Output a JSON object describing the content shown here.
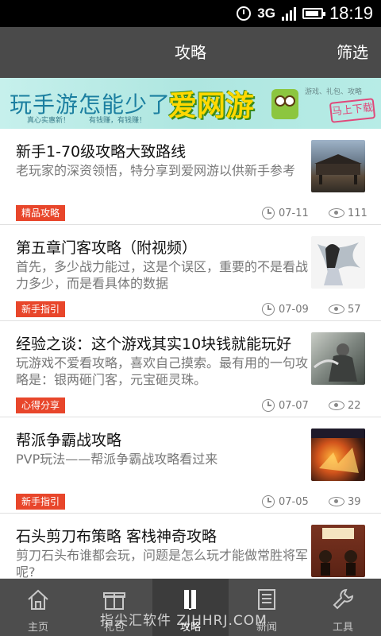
{
  "status_bar": {
    "network": "3G",
    "time": "18:19"
  },
  "header": {
    "title": "攻略",
    "filter_label": "筛选"
  },
  "banner": {
    "slogan": "玩手游怎能少了",
    "small_text_1": "真心实惠新！",
    "small_text_2": "有钱赚，有钱赚！",
    "brand": "爱网游",
    "tagline": "游戏、礼包、攻略",
    "download": "马上下载"
  },
  "articles": [
    {
      "title": "新手1-70级攻略大致路线",
      "desc": "老玩家的深资领悟，特分享到爱网游以供新手参考",
      "tag": "精品攻略",
      "date": "07-11",
      "views": "111"
    },
    {
      "title": "第五章门客攻略（附视频）",
      "desc": "首先，多少战力能过，这是个误区，重要的不是看战力多少，而是看具体的数据",
      "tag": "新手指引",
      "date": "07-09",
      "views": "57"
    },
    {
      "title": "经验之谈：这个游戏其实10块钱就能玩好",
      "desc": "玩游戏不爱看攻略，喜欢自己摸索。最有用的一句攻略是：银两砸门客，元宝砸灵珠。",
      "tag": "心得分享",
      "date": "07-07",
      "views": "22"
    },
    {
      "title": "帮派争霸战攻略",
      "desc": "PVP玩法——帮派争霸战攻略看过来",
      "tag": "新手指引",
      "date": "07-05",
      "views": "39"
    },
    {
      "title": "石头剪刀布策略 客栈神奇攻略",
      "desc": "剪刀石头布谁都会玩，问题是怎么玩才能做常胜将军呢?",
      "tag": "",
      "date": "",
      "views": ""
    }
  ],
  "bottom_nav": [
    {
      "label": "主页",
      "icon": "home-icon"
    },
    {
      "label": "礼包",
      "icon": "gift-icon"
    },
    {
      "label": "攻略",
      "icon": "guide-icon"
    },
    {
      "label": "新闻",
      "icon": "news-icon"
    },
    {
      "label": "工具",
      "icon": "wrench-icon"
    }
  ],
  "watermark": "指尖汇软件 ZJHHRJ.COM",
  "colors": {
    "header_bg": "#4a4a4a",
    "tag_bg": "#e8462b",
    "nav_bg": "#4d4d4d"
  }
}
